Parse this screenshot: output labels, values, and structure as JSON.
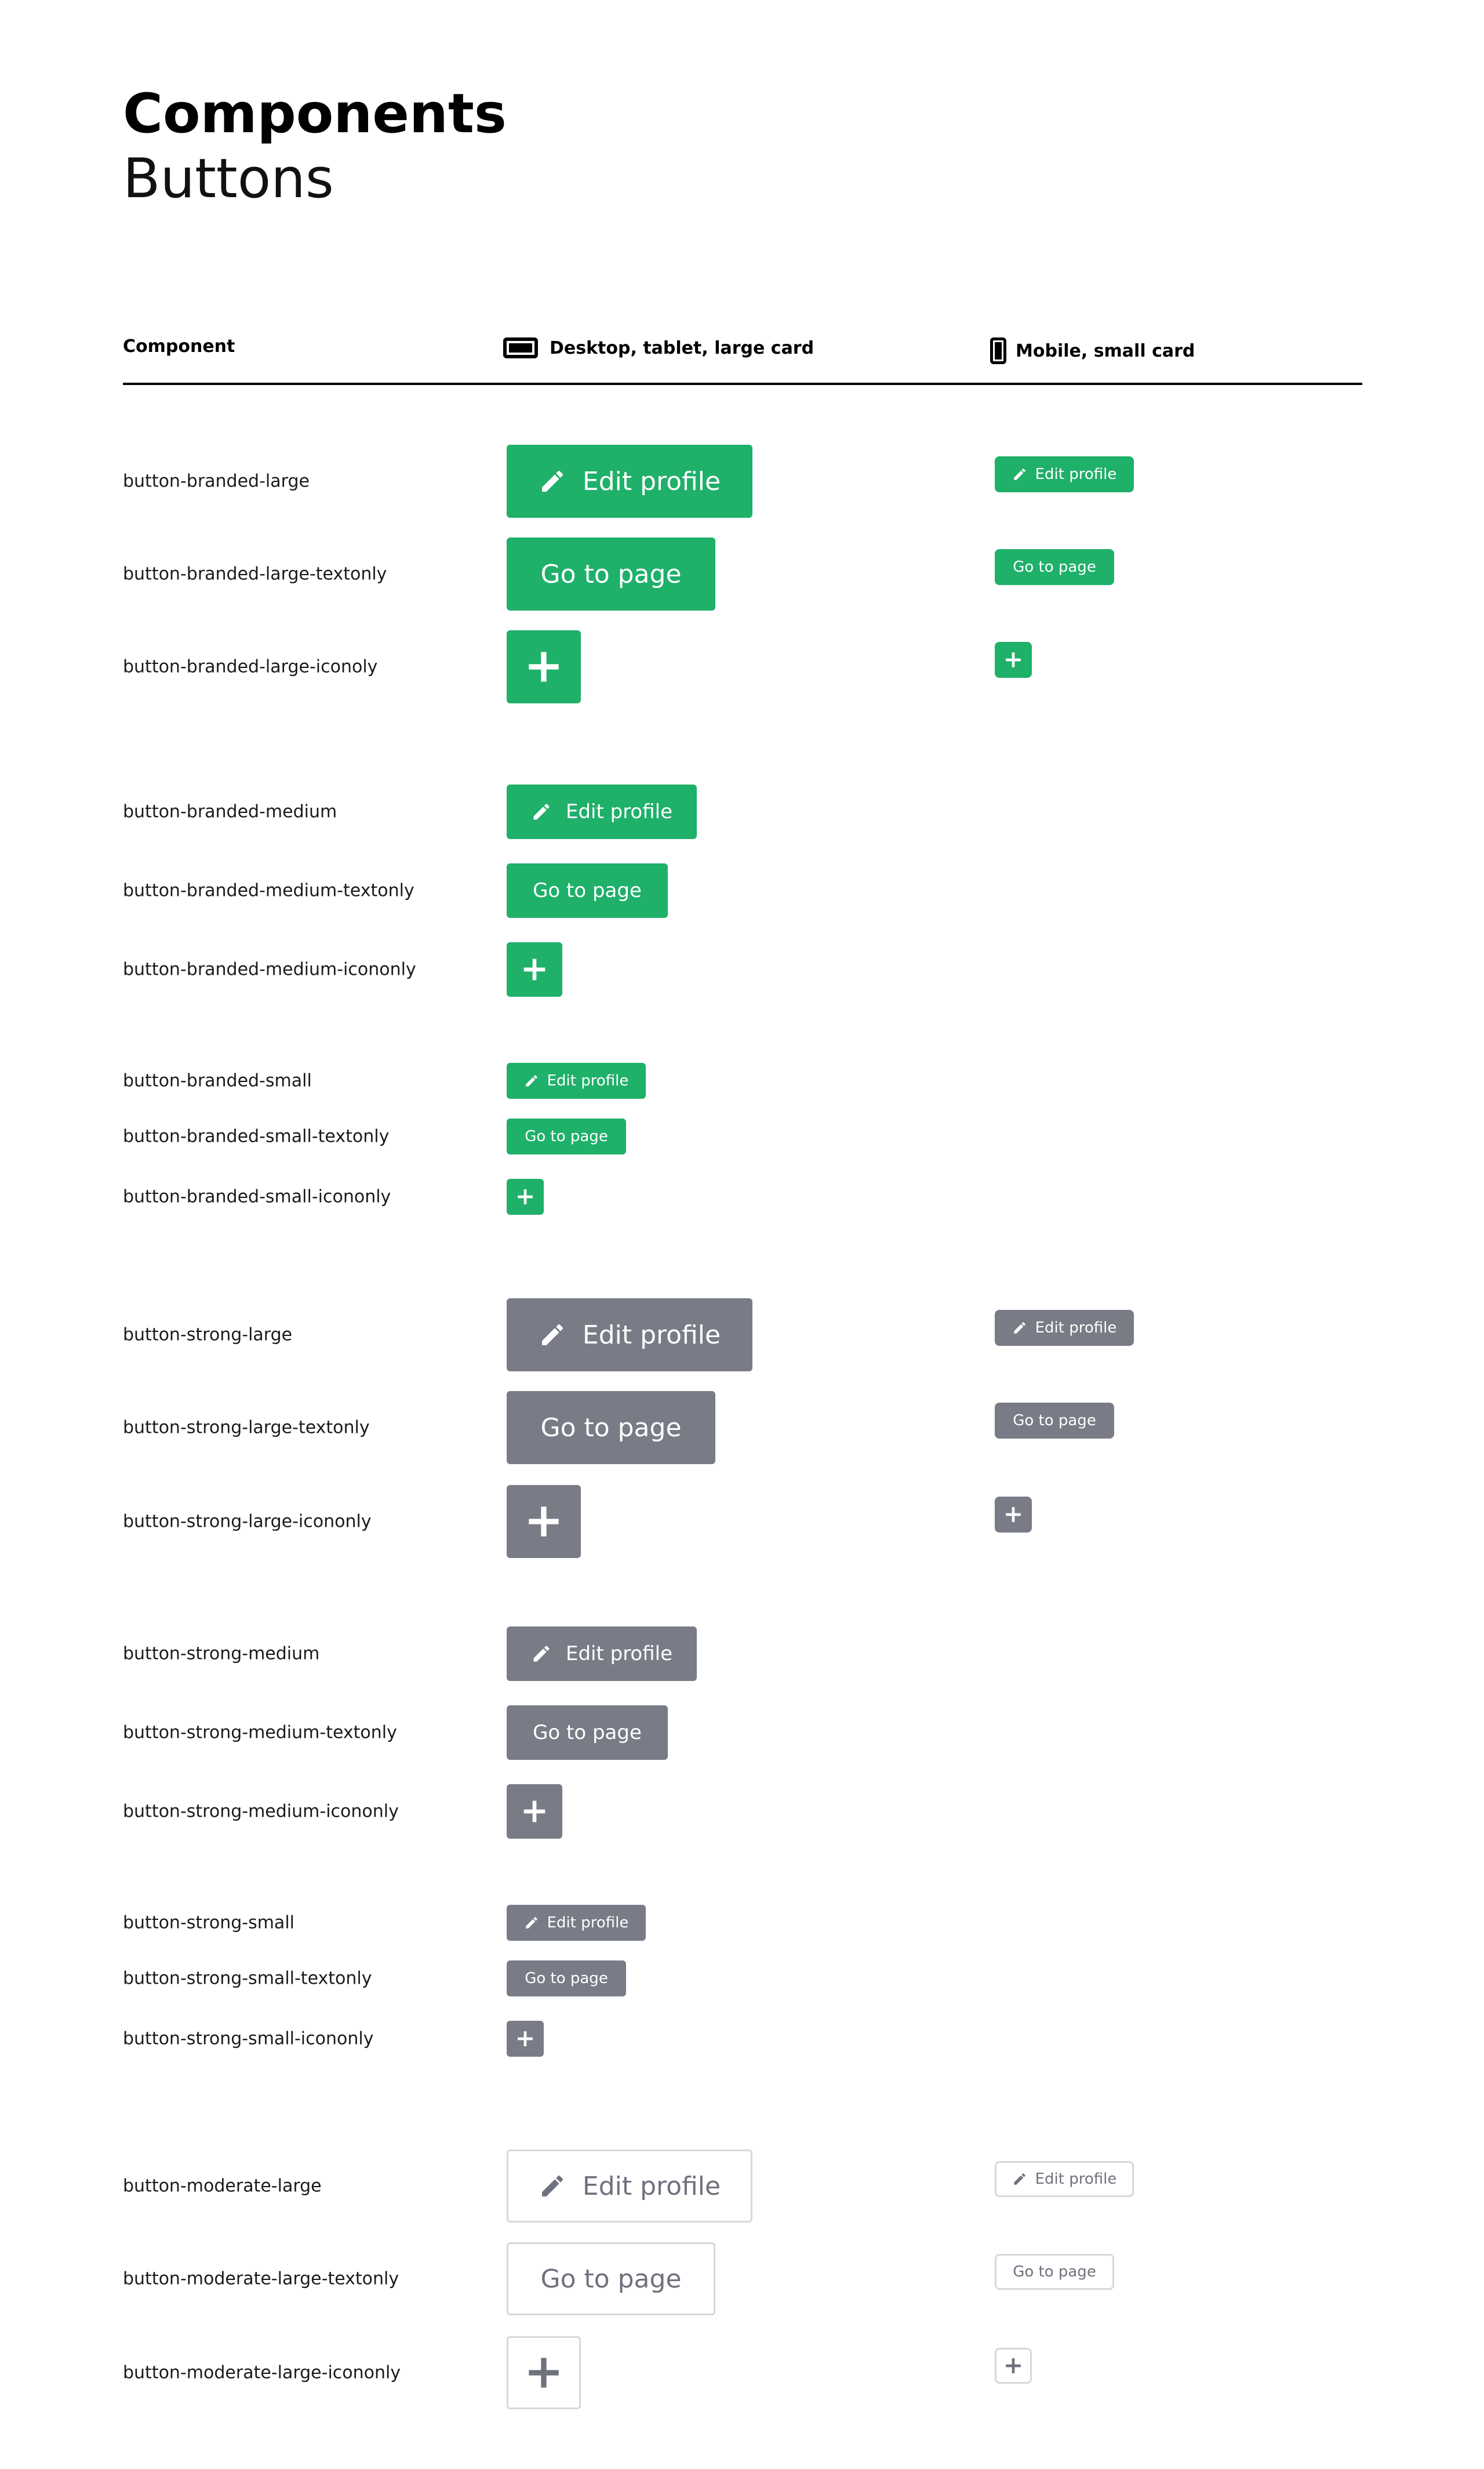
{
  "header": {
    "title": "Components",
    "subtitle": "Buttons"
  },
  "table": {
    "col_component": "Component",
    "col_desktop": "Desktop, tablet, large card",
    "col_mobile": "Mobile, small card"
  },
  "labels": {
    "edit": "Edit profile",
    "goto": "Go to page"
  },
  "colors": {
    "branded": "#1fb06a",
    "strong": "#797b86",
    "moderate_border": "#d6d8de",
    "moderate_text": "#6f717c"
  },
  "icons": {
    "edit": "pencil-icon",
    "add": "plus-icon",
    "desktop": "desktop-icon",
    "mobile": "mobile-icon"
  },
  "rows": [
    "button-branded-large",
    "button-branded-large-textonly",
    "button-branded-large-iconoly",
    "button-branded-medium",
    "button-branded-medium-textonly",
    "button-branded-medium-icononly",
    "button-branded-small",
    "button-branded-small-textonly",
    "button-branded-small-icononly",
    "button-strong-large",
    "button-strong-large-textonly",
    "button-strong-large-icononly",
    "button-strong-medium",
    "button-strong-medium-textonly",
    "button-strong-medium-icononly",
    "button-strong-small",
    "button-strong-small-textonly",
    "button-strong-small-icononly",
    "button-moderate-large",
    "button-moderate-large-textonly",
    "button-moderate-large-icononly"
  ]
}
